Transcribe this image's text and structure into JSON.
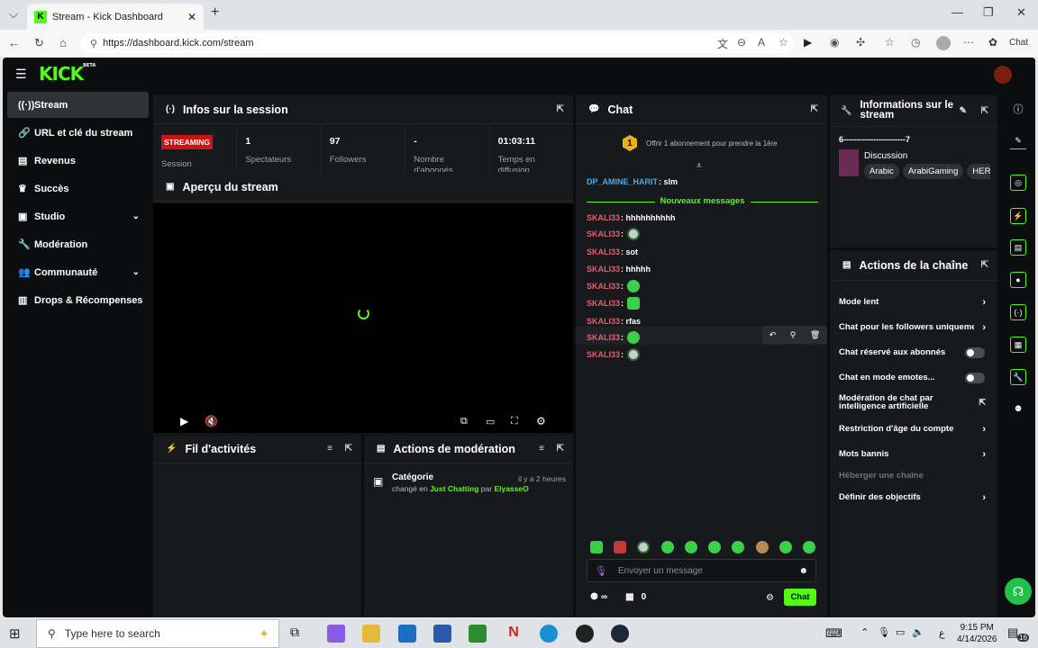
{
  "browser": {
    "tab_title": "Stream - Kick Dashboard",
    "url": "https://dashboard.kick.com/stream",
    "copilot_label": "Chat"
  },
  "app": {
    "logo": "KICK",
    "logo_beta": "BETA"
  },
  "sidebar": {
    "items": [
      {
        "label": "Stream",
        "icon": "broadcast-icon"
      },
      {
        "label": "URL et clé du stream",
        "icon": "link-icon"
      },
      {
        "label": "Revenus",
        "icon": "chart-icon"
      },
      {
        "label": "Succès",
        "icon": "trophy-icon"
      },
      {
        "label": "Studio",
        "icon": "studio-icon"
      },
      {
        "label": "Modération",
        "icon": "wrench-icon"
      },
      {
        "label": "Communauté",
        "icon": "community-icon"
      },
      {
        "label": "Drops & Récompenses",
        "icon": "drops-icon"
      }
    ]
  },
  "session": {
    "title": "Infos sur la session",
    "badge": "STREAMING",
    "session_label": "Session",
    "stats": [
      {
        "value": "1",
        "label": "Spectateurs"
      },
      {
        "value": "97",
        "label": "Followers"
      },
      {
        "value": "-",
        "label": "Nombre d'abonnés"
      },
      {
        "value": "01:03:11",
        "label": "Temps en diffusion"
      }
    ]
  },
  "preview": {
    "title": "Aperçu du stream"
  },
  "activity": {
    "title": "Fil d'activités"
  },
  "moderation": {
    "title": "Actions de modération",
    "item_title": "Catégorie",
    "item_time": "il y a 2 heures",
    "item_changed": "changé en",
    "item_category": "Just Chatting",
    "item_by": "par",
    "item_user": "ElyasseO"
  },
  "chat": {
    "title": "Chat",
    "sub_offer": "Offrir 1 abonnement pour prendre la 1ère",
    "sub_count": "1",
    "first_user": "DP_AMINE_HARIT",
    "first_text": ": slm",
    "new_messages": "Nouveaux messages",
    "messages": [
      {
        "user": "SKALI33",
        "text": ": hhhhhhhhhh"
      },
      {
        "user": "SKALI33",
        "text": ":"
      },
      {
        "user": "SKALI33",
        "text": ": sot"
      },
      {
        "user": "SKALI33",
        "text": ": hhhhh"
      },
      {
        "user": "SKALI33",
        "text": ":"
      },
      {
        "user": "SKALI33",
        "text": ":"
      },
      {
        "user": "SKALI33",
        "text": ": rfas"
      },
      {
        "user": "SKALI33",
        "text": ":"
      },
      {
        "user": "SKALI33",
        "text": ":"
      }
    ],
    "input_placeholder": "Envoyer un message",
    "infinity": "∞",
    "store_count": "0",
    "send_label": "Chat"
  },
  "stream_info": {
    "title": "Informations sur le stream",
    "stream_name": "6-----------------------7",
    "category": "Discussion",
    "tags": [
      "Arabic",
      "ArabiGaming",
      "HERI"
    ]
  },
  "channel_actions": {
    "title": "Actions de la chaîne",
    "items": [
      {
        "label": "Mode lent",
        "control": "chevron"
      },
      {
        "label": "Chat pour les followers uniquement",
        "control": "chevron"
      },
      {
        "label": "Chat réservé aux abonnés",
        "control": "toggle"
      },
      {
        "label": "Chat en mode emotes...",
        "control": "toggle"
      },
      {
        "label": "Modération de chat par intelligence artificielle",
        "control": "external"
      },
      {
        "label": "Restriction d'âge du compte",
        "control": "chevron"
      },
      {
        "label": "Mots bannis",
        "control": "chevron"
      },
      {
        "label": "Héberger une chaîne",
        "control": "none"
      },
      {
        "label": "Définir des objectifs",
        "control": "chevron"
      }
    ]
  },
  "taskbar": {
    "search_placeholder": "Type here to search",
    "time": "9:15 PM",
    "date": "4/14/2026",
    "lang": "ع",
    "notif_count": "16"
  },
  "colors": {
    "accent": "#53fc18",
    "panel": "#17191c",
    "bg": "#0b0d0e",
    "username": "#e0606f",
    "badge": "#c81515"
  }
}
